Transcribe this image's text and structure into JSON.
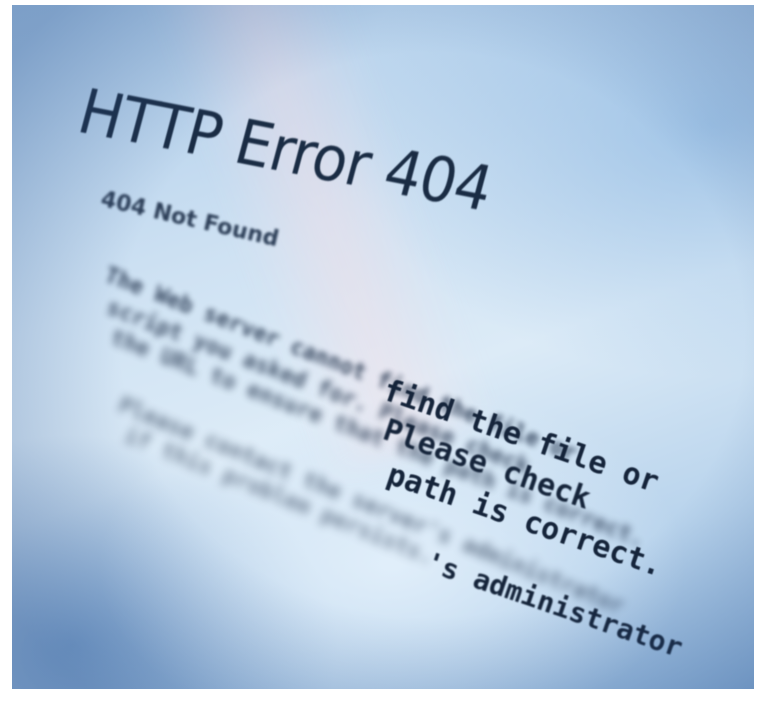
{
  "screen": {
    "title": "HTTP Error 404",
    "subtitle": "404 Not Found",
    "blurred_lines": [
      "The Web server cannot find the file or",
      "script you asked for. Please check",
      "the URL to ensure that the path is correct.",
      "Please contact the server's administrator",
      "if this problem persists."
    ],
    "sharp_lines": [
      "find the file or",
      "Please check",
      "path is correct.",
      "'s administrator"
    ]
  },
  "colors": {
    "text": "#1a2c44",
    "screen_light": "#dcebf7",
    "screen_dark": "#8fb4da"
  }
}
